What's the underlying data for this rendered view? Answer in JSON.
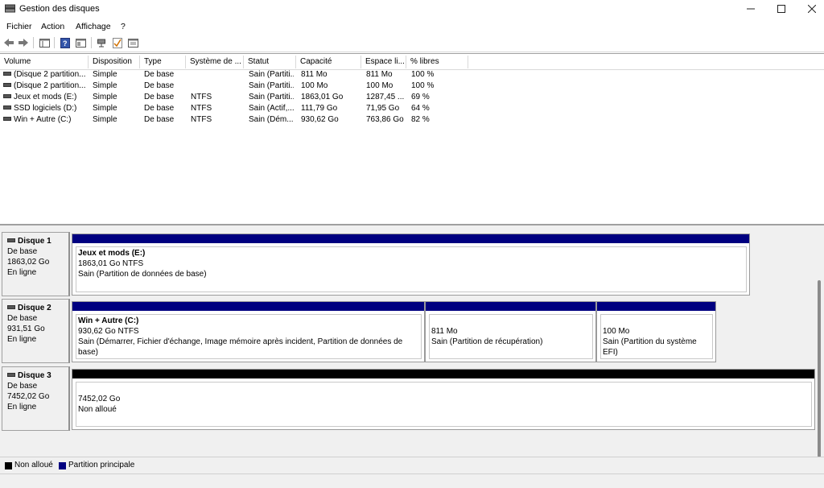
{
  "window": {
    "title": "Gestion des disques"
  },
  "menu": [
    "Fichier",
    "Action",
    "Affichage",
    "?"
  ],
  "toolbar_icons": [
    "back-arrow-icon",
    "forward-arrow-icon",
    "console-tree-icon",
    "help-icon",
    "properties-icon",
    "connect-icon",
    "checklist-icon",
    "settings-icon"
  ],
  "columns": [
    "Volume",
    "Disposition",
    "Type",
    "Système de ...",
    "Statut",
    "Capacité",
    "Espace li...",
    "% libres"
  ],
  "volumes": [
    {
      "volume": "(Disque 2 partition...",
      "disposition": "Simple",
      "type": "De base",
      "fs": "",
      "status": "Sain (Partiti...",
      "capacity": "811 Mo",
      "free": "811 Mo",
      "pct": "100 %"
    },
    {
      "volume": "(Disque 2 partition...",
      "disposition": "Simple",
      "type": "De base",
      "fs": "",
      "status": "Sain (Partiti...",
      "capacity": "100 Mo",
      "free": "100 Mo",
      "pct": "100 %"
    },
    {
      "volume": "Jeux et mods (E:)",
      "disposition": "Simple",
      "type": "De base",
      "fs": "NTFS",
      "status": "Sain (Partiti...",
      "capacity": "1863,01 Go",
      "free": "1287,45 ...",
      "pct": "69 %"
    },
    {
      "volume": "SSD logiciels (D:)",
      "disposition": "Simple",
      "type": "De base",
      "fs": "NTFS",
      "status": "Sain (Actif,...",
      "capacity": "111,79 Go",
      "free": "71,95 Go",
      "pct": "64 %"
    },
    {
      "volume": "Win + Autre (C:)",
      "disposition": "Simple",
      "type": "De base",
      "fs": "NTFS",
      "status": "Sain (Dém...",
      "capacity": "930,62 Go",
      "free": "763,86 Go",
      "pct": "82 %"
    }
  ],
  "disks": [
    {
      "name": "Disque 1",
      "type": "De base",
      "size": "1863,02 Go",
      "state": "En ligne",
      "partitions": [
        {
          "label": "Jeux et mods  (E:)",
          "size": "1863,01 Go NTFS",
          "status": "Sain (Partition de données de base)"
        }
      ]
    },
    {
      "name": "Disque 2",
      "type": "De base",
      "size": "931,51 Go",
      "state": "En ligne",
      "partitions": [
        {
          "label": "Win + Autre  (C:)",
          "size": "930,62 Go NTFS",
          "status": "Sain (Démarrer, Fichier d'échange, Image mémoire après incident, Partition de données de base)"
        },
        {
          "label": "",
          "size": "811 Mo",
          "status": "Sain (Partition de récupération)"
        },
        {
          "label": "",
          "size": "100 Mo",
          "status": "Sain (Partition du système EFI)"
        }
      ]
    },
    {
      "name": "Disque 3",
      "type": "De base",
      "size": "7452,02 Go",
      "state": "En ligne",
      "partitions": [
        {
          "label": "",
          "size": "7452,02 Go",
          "status": "Non alloué"
        }
      ]
    }
  ],
  "legend": [
    {
      "label": "Non alloué",
      "color": "#000000"
    },
    {
      "label": "Partition principale",
      "color": "#000080"
    }
  ],
  "colors": {
    "primary_partition": "#000080",
    "unallocated": "#000000"
  }
}
